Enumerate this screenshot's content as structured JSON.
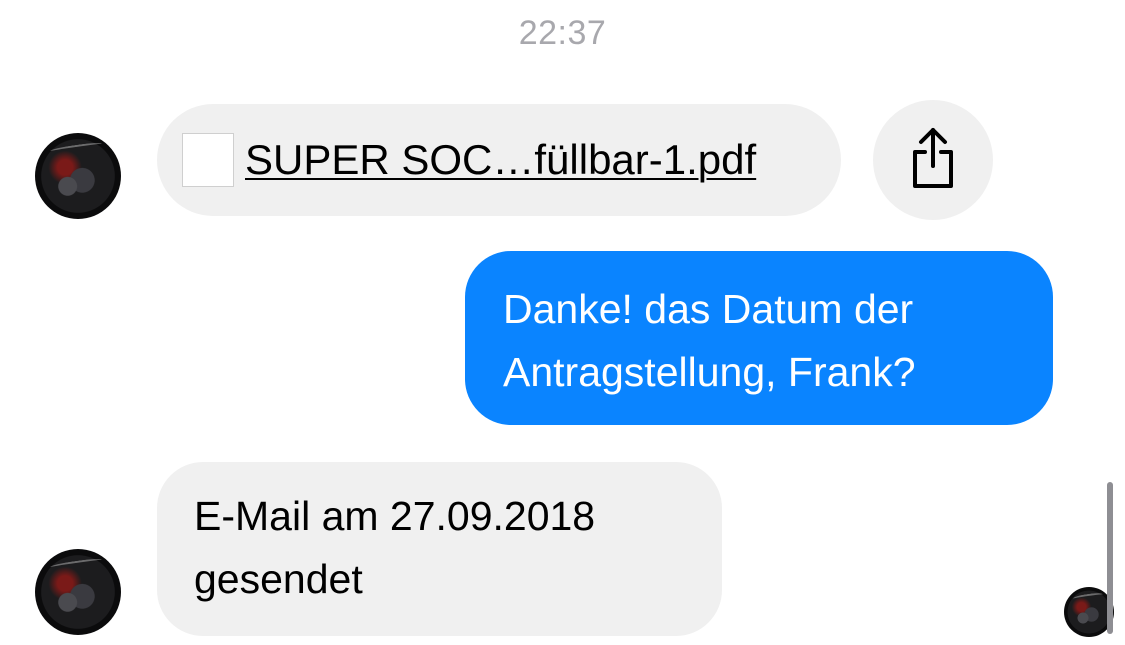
{
  "conversation": {
    "timestamp": "22:37"
  },
  "messages": [
    {
      "direction": "incoming",
      "type": "file",
      "file_name": "SUPER SOC…füllbar-1.pdf"
    },
    {
      "direction": "outgoing",
      "type": "text",
      "lines": [
        "Danke! das Datum der",
        "Antragstellung, Frank?"
      ]
    },
    {
      "direction": "incoming",
      "type": "text",
      "lines": [
        "E-Mail am 27.09.2018",
        "gesendet"
      ]
    }
  ],
  "icons": {
    "share": "share-icon",
    "file": "file-placeholder-icon"
  },
  "colors": {
    "outgoing_bubble": "#0a84ff",
    "incoming_bubble": "#f0f0f0",
    "timestamp": "#a8a8ad"
  }
}
